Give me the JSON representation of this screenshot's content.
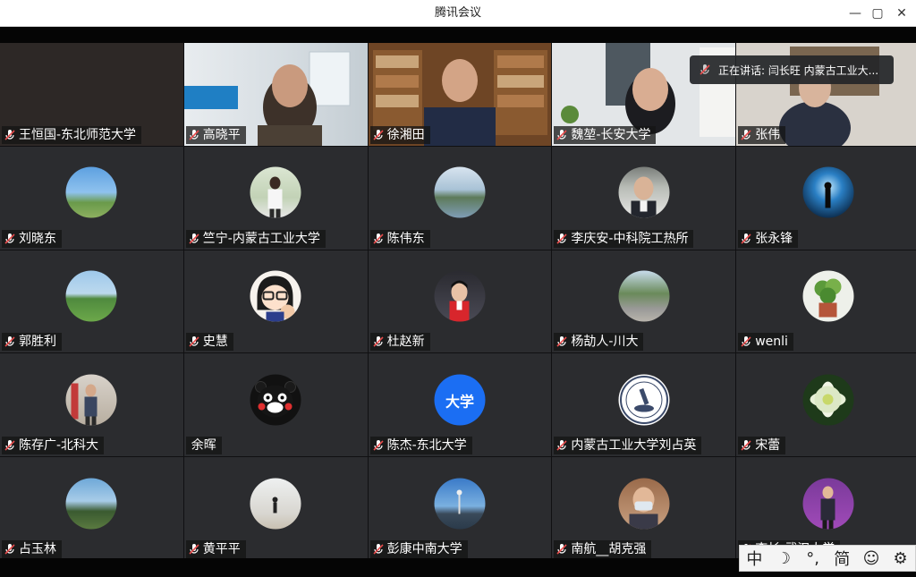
{
  "window": {
    "title": "腾讯会议",
    "minimize_glyph": "—",
    "maximize_glyph": "▢",
    "close_glyph": "✕"
  },
  "speaking_banner": {
    "text": "正在讲话: 闫长旺 内蒙古工业大...",
    "icon": "mic-muted-icon"
  },
  "colors": {
    "accent_blue": "#1b6ef3",
    "mic_red": "#e74c4c"
  },
  "participants": [
    {
      "name": "王恒国-东北师范大学",
      "kind": "video"
    },
    {
      "name": "高晓平",
      "kind": "video"
    },
    {
      "name": "徐湘田",
      "kind": "video"
    },
    {
      "name": "魏堃-长安大学",
      "kind": "video"
    },
    {
      "name": "张伟",
      "kind": "video"
    },
    {
      "name": "刘晓东",
      "kind": "avatar"
    },
    {
      "name": "竺宁-内蒙古工业大学",
      "kind": "avatar"
    },
    {
      "name": "陈伟东",
      "kind": "avatar"
    },
    {
      "name": "李庆安-中科院工热所",
      "kind": "avatar"
    },
    {
      "name": "张永锋",
      "kind": "avatar"
    },
    {
      "name": "郭胜利",
      "kind": "avatar"
    },
    {
      "name": "史慧",
      "kind": "avatar"
    },
    {
      "name": "杜赵新",
      "kind": "avatar"
    },
    {
      "name": "杨劼人-川大",
      "kind": "avatar"
    },
    {
      "name": "wenli",
      "kind": "avatar"
    },
    {
      "name": "陈存广-北科大",
      "kind": "avatar"
    },
    {
      "name": "余晖",
      "kind": "avatar"
    },
    {
      "name": "陈杰-东北大学",
      "kind": "avatar",
      "avatar_text": "大学"
    },
    {
      "name": "内蒙古工业大学刘占英",
      "kind": "avatar"
    },
    {
      "name": "宋蕾",
      "kind": "avatar"
    },
    {
      "name": "占玉林",
      "kind": "avatar"
    },
    {
      "name": "黄平平",
      "kind": "avatar"
    },
    {
      "name": "彭康中南大学",
      "kind": "avatar"
    },
    {
      "name": "南航__胡克强",
      "kind": "avatar"
    },
    {
      "name": "李杉-武汉大学",
      "kind": "avatar"
    }
  ],
  "ime_toolbar": {
    "items": [
      "中",
      "☽",
      "°,",
      "简",
      "☺",
      "⚙"
    ]
  }
}
